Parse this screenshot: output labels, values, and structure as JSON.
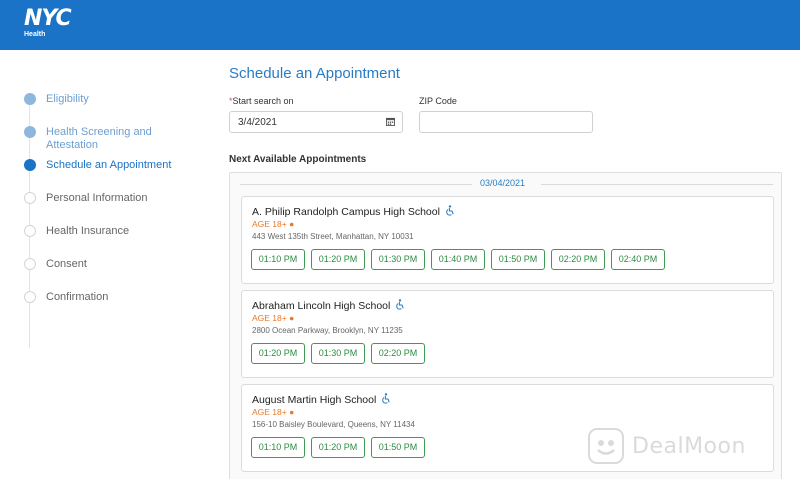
{
  "header": {
    "logo_mark": "NYC",
    "logo_sub": "Health",
    "brand_color": "#1a73c6"
  },
  "steps": [
    {
      "label": "Eligibility",
      "state": "done"
    },
    {
      "label": "Health Screening and Attestation",
      "state": "done"
    },
    {
      "label": "Schedule an Appointment",
      "state": "active"
    },
    {
      "label": "Personal Information",
      "state": "todo"
    },
    {
      "label": "Health Insurance",
      "state": "todo"
    },
    {
      "label": "Consent",
      "state": "todo"
    },
    {
      "label": "Confirmation",
      "state": "todo"
    }
  ],
  "main": {
    "title": "Schedule an Appointment",
    "start_search": {
      "required_mark": "*",
      "label": "Start search on",
      "value": "3/4/2021",
      "icon": "calendar-icon"
    },
    "zip": {
      "label": "ZIP Code",
      "value": ""
    },
    "next_title": "Next Available Appointments",
    "date_header": "03/04/2021",
    "sites": [
      {
        "name": "A. Philip Randolph Campus High School",
        "icon": "accessibility-icon",
        "age": "AGE 18+ ●",
        "address": "443 West 135th Street, Manhattan, NY 10031",
        "slots": [
          "01:10 PM",
          "01:20 PM",
          "01:30 PM",
          "01:40 PM",
          "01:50 PM",
          "02:20 PM",
          "02:40 PM"
        ]
      },
      {
        "name": "Abraham Lincoln High School",
        "icon": "accessibility-icon",
        "age": "AGE 18+ ●",
        "address": "2800 Ocean Parkway, Brooklyn, NY 11235",
        "slots": [
          "01:20 PM",
          "01:30 PM",
          "02:20 PM"
        ]
      },
      {
        "name": "August Martin High School",
        "icon": "accessibility-icon",
        "age": "AGE 18+ ●",
        "address": "156-10 Baisley Boulevard, Queens, NY 11434",
        "slots": [
          "01:10 PM",
          "01:20 PM",
          "01:50 PM"
        ]
      }
    ]
  },
  "watermark": {
    "text": "DealMoon"
  }
}
